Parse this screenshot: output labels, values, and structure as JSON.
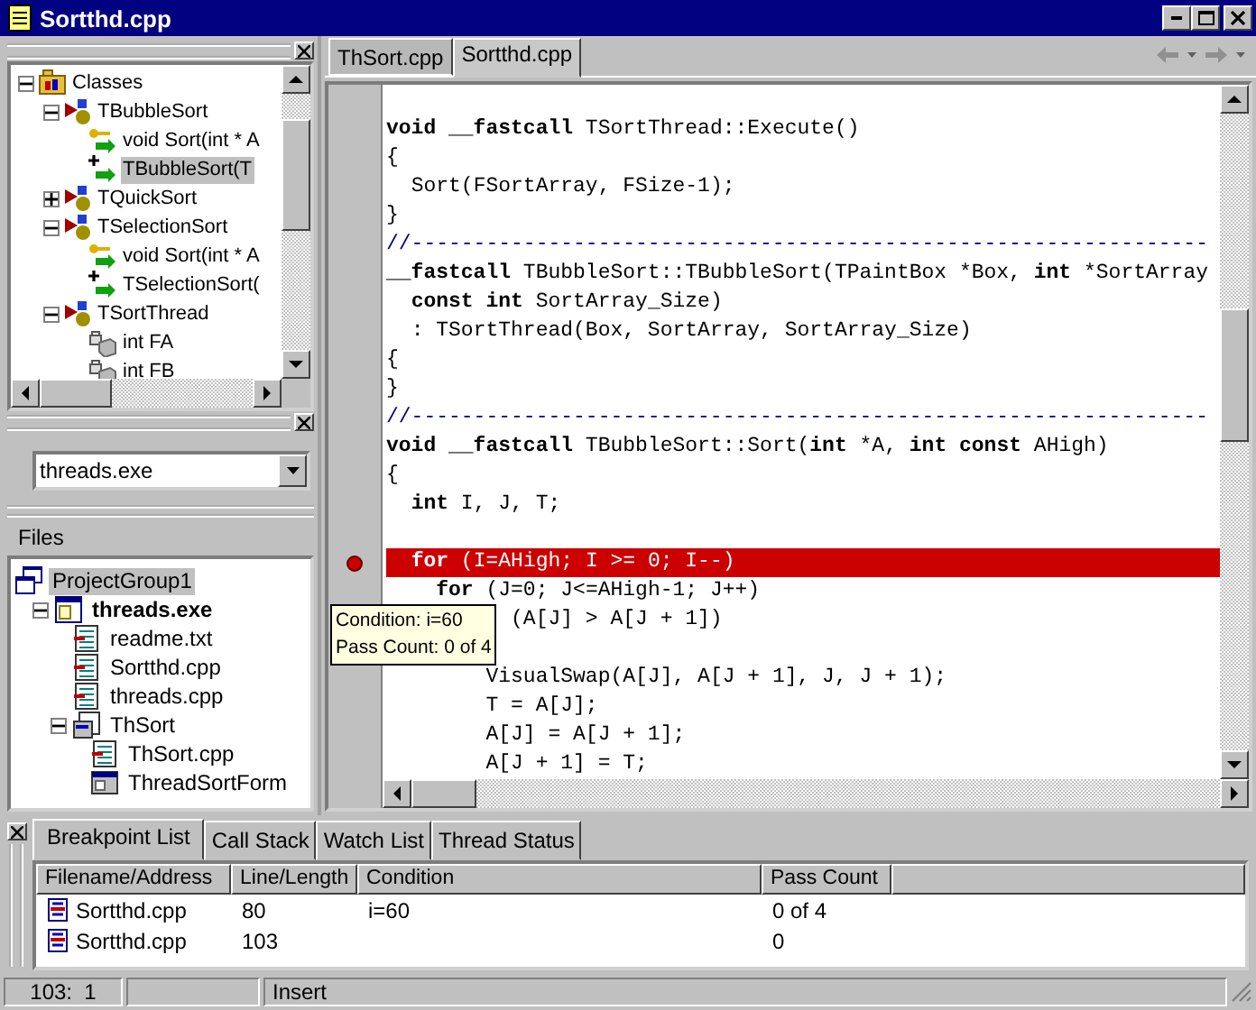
{
  "window": {
    "title": "Sortthd.cpp"
  },
  "class_tree": {
    "items": [
      {
        "label": "Classes",
        "kind": "namespace",
        "expanded": true,
        "selected": false,
        "children": [
          {
            "label": "TBubbleSort",
            "kind": "class",
            "expanded": true,
            "selected": false,
            "children": [
              {
                "label": "void Sort(int * A",
                "kind": "method",
                "selected": false
              },
              {
                "label": "TBubbleSort(T",
                "kind": "constructor",
                "selected": true
              }
            ]
          },
          {
            "label": "TQuickSort",
            "kind": "class",
            "expanded": false,
            "selected": false
          },
          {
            "label": "TSelectionSort",
            "kind": "class",
            "expanded": true,
            "selected": false,
            "children": [
              {
                "label": "void Sort(int * A",
                "kind": "method",
                "selected": false
              },
              {
                "label": "TSelectionSort(",
                "kind": "constructor",
                "selected": false
              }
            ]
          },
          {
            "label": "TSortThread",
            "kind": "class",
            "expanded": true,
            "selected": false,
            "children": [
              {
                "label": "int FA",
                "kind": "field",
                "selected": false
              },
              {
                "label": "int FB",
                "kind": "field",
                "selected": false
              }
            ]
          }
        ]
      }
    ]
  },
  "target_select": {
    "value": "threads.exe"
  },
  "files_panel": {
    "title": "Files",
    "items": [
      {
        "label": "ProjectGroup1",
        "kind": "group",
        "selected": true,
        "children": [
          {
            "label": "threads.exe",
            "kind": "project",
            "expanded": true,
            "selected": false,
            "children": [
              {
                "label": "readme.txt",
                "kind": "file",
                "selected": false
              },
              {
                "label": "Sortthd.cpp",
                "kind": "file",
                "selected": false
              },
              {
                "label": "threads.cpp",
                "kind": "file",
                "selected": false
              },
              {
                "label": "ThSort",
                "kind": "unit",
                "expanded": true,
                "selected": false,
                "children": [
                  {
                    "label": "ThSort.cpp",
                    "kind": "file",
                    "selected": false
                  },
                  {
                    "label": "ThreadSortForm",
                    "kind": "form",
                    "selected": false
                  }
                ]
              }
            ]
          }
        ]
      }
    ]
  },
  "editor": {
    "tabs": [
      {
        "label": "ThSort.cpp",
        "selected": false
      },
      {
        "label": "Sortthd.cpp",
        "selected": true
      }
    ],
    "lines": [
      {
        "breakpoint": false
      },
      {
        "breakpoint": false,
        "tokens": [
          {
            "kind": "keyword",
            "text": "void __fastcall"
          },
          {
            "kind": "plain",
            "text": " TSortThread::Execute()"
          }
        ]
      },
      {
        "breakpoint": false,
        "tokens": [
          {
            "kind": "plain",
            "text": "{"
          }
        ]
      },
      {
        "breakpoint": false,
        "tokens": [
          {
            "kind": "plain",
            "text": "  Sort(FSortArray, FSize-1);"
          }
        ]
      },
      {
        "breakpoint": false,
        "tokens": [
          {
            "kind": "plain",
            "text": "}"
          }
        ]
      },
      {
        "breakpoint": false,
        "tokens": [
          {
            "kind": "comment",
            "text": "//----------------------------------------------------------------"
          }
        ]
      },
      {
        "breakpoint": false,
        "tokens": [
          {
            "kind": "keyword",
            "text": "__fastcall"
          },
          {
            "kind": "plain",
            "text": " TBubbleSort::TBubbleSort(TPaintBox *Box, "
          },
          {
            "kind": "keyword",
            "text": "int"
          },
          {
            "kind": "plain",
            "text": " *SortArray"
          }
        ]
      },
      {
        "breakpoint": false,
        "tokens": [
          {
            "kind": "keyword",
            "text": "  const int"
          },
          {
            "kind": "plain",
            "text": " SortArray_Size)"
          }
        ]
      },
      {
        "breakpoint": false,
        "tokens": [
          {
            "kind": "plain",
            "text": "  : TSortThread(Box, SortArray, SortArray_Size)"
          }
        ]
      },
      {
        "breakpoint": false,
        "tokens": [
          {
            "kind": "plain",
            "text": "{"
          }
        ]
      },
      {
        "breakpoint": false,
        "tokens": [
          {
            "kind": "plain",
            "text": "}"
          }
        ]
      },
      {
        "breakpoint": false,
        "tokens": [
          {
            "kind": "comment",
            "text": "//----------------------------------------------------------------"
          }
        ]
      },
      {
        "breakpoint": false,
        "tokens": [
          {
            "kind": "keyword",
            "text": "void __fastcall"
          },
          {
            "kind": "plain",
            "text": " TBubbleSort::Sort("
          },
          {
            "kind": "keyword",
            "text": "int"
          },
          {
            "kind": "plain",
            "text": " *A, "
          },
          {
            "kind": "keyword",
            "text": "int const"
          },
          {
            "kind": "plain",
            "text": " AHigh)"
          }
        ]
      },
      {
        "breakpoint": false,
        "tokens": [
          {
            "kind": "plain",
            "text": "{"
          }
        ]
      },
      {
        "breakpoint": false,
        "tokens": [
          {
            "kind": "keyword",
            "text": "  int"
          },
          {
            "kind": "plain",
            "text": " I, J, T;"
          }
        ]
      },
      {
        "breakpoint": false
      },
      {
        "breakpoint": true,
        "tokens": [
          {
            "kind": "keyword",
            "text": "  for"
          },
          {
            "kind": "plain",
            "text": " (I=AHigh; I >= 0; I--)"
          }
        ]
      },
      {
        "breakpoint": false,
        "tokens": [
          {
            "kind": "keyword",
            "text": "    for"
          },
          {
            "kind": "plain",
            "text": " (J=0; J<=AHigh-1; J++)"
          }
        ]
      },
      {
        "breakpoint": false,
        "tokens": [
          {
            "kind": "plain",
            "text": "          (A[J] > A[J + 1])"
          }
        ]
      },
      {
        "breakpoint": false
      },
      {
        "breakpoint": false,
        "tokens": [
          {
            "kind": "plain",
            "text": "        VisualSwap(A[J], A[J + 1], J, J + 1);"
          }
        ]
      },
      {
        "breakpoint": false,
        "tokens": [
          {
            "kind": "plain",
            "text": "        T = A[J];"
          }
        ]
      },
      {
        "breakpoint": false,
        "tokens": [
          {
            "kind": "plain",
            "text": "        A[J] = A[J + 1];"
          }
        ]
      },
      {
        "breakpoint": false,
        "tokens": [
          {
            "kind": "plain",
            "text": "        A[J + 1] = T;"
          }
        ]
      }
    ],
    "tooltip": [
      "Condition: i=60",
      "Pass Count: 0 of 4"
    ]
  },
  "debug_tabs": [
    {
      "label": "Breakpoint List",
      "selected": true
    },
    {
      "label": "Call Stack",
      "selected": false
    },
    {
      "label": "Watch List",
      "selected": false
    },
    {
      "label": "Thread Status",
      "selected": false
    }
  ],
  "breakpoints": {
    "columns": [
      "Filename/Address",
      "Line/Length",
      "Condition",
      "Pass Count"
    ],
    "rows": [
      {
        "file": "Sortthd.cpp",
        "line": "80",
        "condition": "i=60",
        "pass_count": "0 of 4"
      },
      {
        "file": "Sortthd.cpp",
        "line": "103",
        "pass_count": "0"
      }
    ]
  },
  "status_bar": {
    "position": "103:  1",
    "mode": "Insert"
  }
}
